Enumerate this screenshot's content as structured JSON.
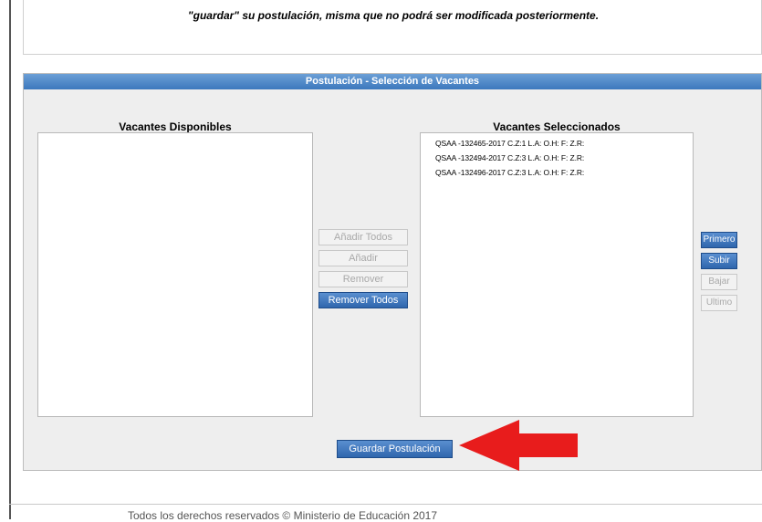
{
  "notice": {
    "text": "\"guardar\" su postulación, misma que no podrá ser modificada posteriormente."
  },
  "panel": {
    "title": "Postulación - Selección de Vacantes",
    "available": {
      "title": "Vacantes Disponibles",
      "items": []
    },
    "selected": {
      "title": "Vacantes Seleccionados",
      "items": [
        "QSAA -132465-2017 C.Z:1 L.A: O.H: F: Z.R:",
        "QSAA -132494-2017 C.Z:3 L.A: O.H: F: Z.R:",
        "QSAA -132496-2017 C.Z:3 L.A: O.H: F: Z.R:"
      ]
    },
    "transfer_buttons": {
      "add_all": "Añadir Todos",
      "add": "Añadir",
      "remove": "Remover",
      "remove_all": "Remover Todos"
    },
    "order_buttons": {
      "first": "Primero",
      "up": "Subir",
      "down": "Bajar",
      "last": "Ultimo"
    },
    "save_button": "Guardar Postulación"
  },
  "annotation": {
    "arrow_color": "#e81c1c",
    "arrow_direction": "left"
  },
  "footer": {
    "text": "Todos los derechos reservados © Ministerio de Educación 2017"
  },
  "colors": {
    "header_blue": "#3c78bd",
    "button_blue": "#2f66ad",
    "panel_bg": "#eeeeee"
  }
}
